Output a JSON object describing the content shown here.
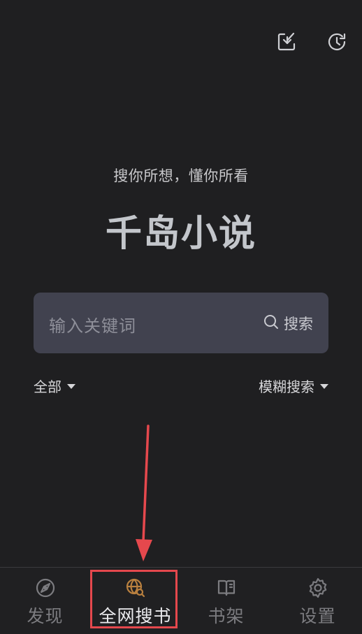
{
  "topbar": {
    "download_icon": "download-box-icon",
    "history_icon": "history-clock-icon"
  },
  "hero": {
    "slogan": "搜你所想，懂你所看",
    "title": "千岛小说"
  },
  "search": {
    "placeholder": "输入关键词",
    "button_label": "搜索"
  },
  "filters": {
    "scope": "全部",
    "mode": "模糊搜索"
  },
  "bottom_nav": {
    "items": [
      {
        "label": "发现",
        "icon": "compass-icon",
        "active": false
      },
      {
        "label": "全网搜书",
        "icon": "globe-search-icon",
        "active": true
      },
      {
        "label": "书架",
        "icon": "book-icon",
        "active": false
      },
      {
        "label": "设置",
        "icon": "gear-icon",
        "active": false
      }
    ]
  },
  "colors": {
    "background": "#1f1f21",
    "search_box": "#41424f",
    "accent_icon": "#b9803f",
    "annotation_red": "#e5484d"
  }
}
